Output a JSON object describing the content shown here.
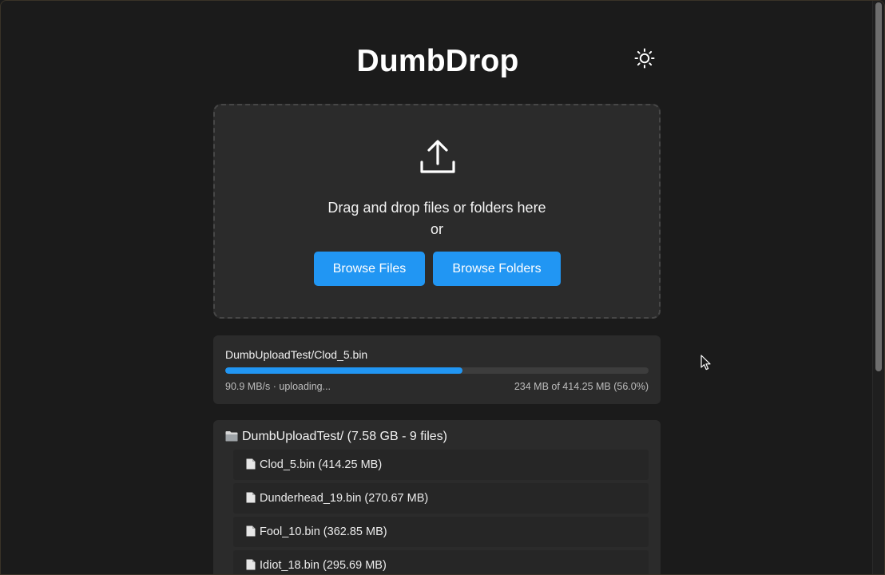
{
  "app": {
    "title": "DumbDrop",
    "theme_toggle_icon": "sun-icon"
  },
  "dropzone": {
    "icon": "upload-icon",
    "text": "Drag and drop files or folders here",
    "or_text": "or",
    "browse_files_label": "Browse Files",
    "browse_folders_label": "Browse Folders"
  },
  "upload_progress": {
    "filename": "DumbUploadTest/Clod_5.bin",
    "percent": 56.0,
    "status": "90.9 MB/s · uploading...",
    "size_text": "234 MB of 414.25 MB (56.0%)"
  },
  "file_list": {
    "folder_icon": "folder-icon",
    "folder_label": "DumbUploadTest/ (7.58 GB - 9 files)",
    "file_icon": "file-icon",
    "items": [
      {
        "label": "Clod_5.bin (414.25 MB)"
      },
      {
        "label": "Dunderhead_19.bin (270.67 MB)"
      },
      {
        "label": "Fool_10.bin (362.85 MB)"
      },
      {
        "label": "Idiot_18.bin (295.69 MB)"
      }
    ]
  },
  "colors": {
    "accent": "#2196f3",
    "background": "#1b1b1b",
    "card": "#2b2b2b"
  }
}
